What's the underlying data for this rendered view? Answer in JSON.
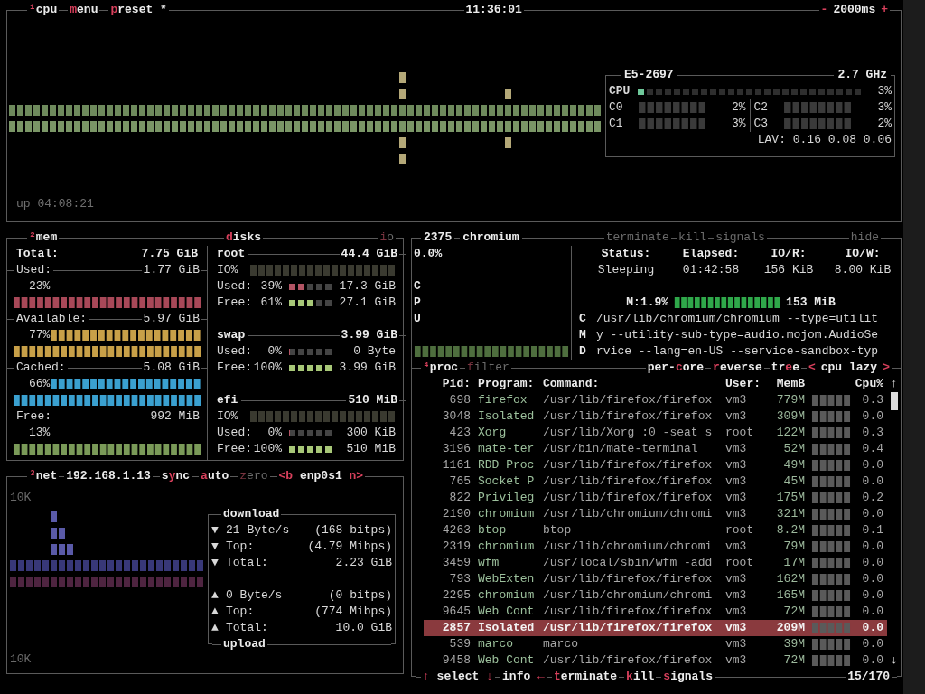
{
  "top_bar": {
    "tabs": [
      {
        "on": true,
        "parts": [
          {
            "text": "¹",
            "hot": true
          },
          {
            "text": "cpu",
            "hot": false
          }
        ]
      },
      {
        "on": true,
        "parts": [
          {
            "text": "m",
            "hot": true
          },
          {
            "text": "enu",
            "hot": false
          }
        ]
      },
      {
        "on": true,
        "parts": [
          {
            "text": "p",
            "hot": true
          },
          {
            "text": "reset *",
            "hot": false
          }
        ]
      }
    ],
    "clock": "11:36:01",
    "interval": {
      "minus": "-",
      "value": "2000ms",
      "plus": "+"
    }
  },
  "cpu": {
    "uptime": "up 04:08:21",
    "model": "E5-2697",
    "freq": "2.7 GHz",
    "total": {
      "label": "CPU",
      "level": 0.03,
      "reading": "3%"
    },
    "cores": [
      {
        "label": "C0",
        "reading": "2%"
      },
      {
        "label": "C2",
        "reading": "3%"
      },
      {
        "label": "C1",
        "reading": "3%"
      },
      {
        "label": "C3",
        "reading": "2%"
      }
    ],
    "load": "LAV: 0.16 0.08 0.06"
  },
  "mem": {
    "tab": {
      "on": true,
      "parts": [
        {
          "text": "²",
          "hot": true
        },
        {
          "text": "mem",
          "hot": false
        }
      ]
    },
    "total_label": "Total:",
    "total": "7.75 GiB",
    "rows": [
      {
        "label": "Used:",
        "value": "1.77 GiB",
        "percent": "23%",
        "kind": "separate",
        "color": "#a84858"
      },
      {
        "label": "Available:",
        "value": "5.97 GiB",
        "percent": "77%",
        "kind": "inline",
        "color": "#c8a048"
      },
      {
        "label": "Cached:",
        "value": "5.08 GiB",
        "percent": "66%",
        "kind": "inline",
        "color": "#3aa0d0"
      },
      {
        "label": "Free:",
        "value": "992 MiB",
        "percent": "13%",
        "kind": "separate",
        "color": "#7a9a58"
      }
    ]
  },
  "disks": {
    "tab": {
      "on": true,
      "parts": [
        {
          "text": "d",
          "hot": true
        },
        {
          "text": "isks",
          "hot": false
        }
      ]
    },
    "io_tab": {
      "on": false,
      "parts": [
        {
          "text": "i",
          "hot": true
        },
        {
          "text": "o",
          "hot": false
        }
      ]
    },
    "items": [
      {
        "name": "root",
        "size": "44.4 GiB",
        "io_label": "IO%",
        "used": {
          "label": "Used:",
          "percent": "39%",
          "level": 0.39,
          "value": "17.3 GiB"
        },
        "free": {
          "label": "Free:",
          "percent": "61%",
          "level": 0.61,
          "value": "27.1 GiB"
        }
      },
      {
        "name": "swap",
        "size": "3.99 GiB",
        "used": {
          "label": "Used:",
          "percent": "0%",
          "level": 0,
          "value": "0 Byte"
        },
        "free": {
          "label": "Free:",
          "percent": "100%",
          "level": 1,
          "value": "3.99 GiB"
        }
      },
      {
        "name": "efi",
        "size": "510 MiB",
        "io_label": "IO%",
        "used": {
          "label": "Used:",
          "percent": "0%",
          "level": 0,
          "value": "300 KiB"
        },
        "free": {
          "label": "Free:",
          "percent": "100%",
          "level": 1,
          "value": "510 MiB"
        }
      }
    ]
  },
  "net": {
    "tab": {
      "on": true,
      "parts": [
        {
          "text": "³",
          "hot": true
        },
        {
          "text": "net",
          "hot": false
        }
      ]
    },
    "ip": "192.168.1.13",
    "toggles": [
      {
        "on": true,
        "parts": [
          {
            "text": "s",
            "hot": false
          },
          {
            "text": "y",
            "hot": true
          },
          {
            "text": "nc",
            "hot": false
          }
        ]
      },
      {
        "on": true,
        "parts": [
          {
            "text": "a",
            "hot": true
          },
          {
            "text": "uto",
            "hot": false
          }
        ]
      },
      {
        "on": false,
        "parts": [
          {
            "text": "z",
            "hot": true
          },
          {
            "text": "ero",
            "hot": false
          }
        ]
      },
      {
        "on": true,
        "parts": [
          {
            "text": "<b",
            "hot": true
          },
          {
            "text": " enp0s1 ",
            "hot": false
          },
          {
            "text": "n>",
            "hot": true
          }
        ]
      }
    ],
    "scale_top": "10K",
    "scale_bottom": "10K",
    "download": {
      "title": "download",
      "rows": [
        {
          "arrow": "▼",
          "label": "21 Byte/s",
          "value": "(168 bitps)"
        },
        {
          "arrow": "▼",
          "label": "Top:",
          "value": "(4.79 Mibps)"
        },
        {
          "arrow": "▼",
          "label": "Total:",
          "value": "2.23 GiB"
        }
      ]
    },
    "upload": {
      "title": "upload",
      "rows": [
        {
          "arrow": "▲",
          "label": "0 Byte/s",
          "value": "(0 bitps)"
        },
        {
          "arrow": "▲",
          "label": "Top:",
          "value": "(774 Mibps)"
        },
        {
          "arrow": "▲",
          "label": "Total:",
          "value": "10.0 GiB"
        }
      ]
    }
  },
  "detail": {
    "pid": "2375",
    "name": "chromium",
    "buttons": [
      {
        "on": false,
        "parts": [
          {
            "text": "terminate",
            "hot": false
          }
        ]
      },
      {
        "on": false,
        "parts": [
          {
            "text": "kill",
            "hot": false
          }
        ]
      },
      {
        "on": false,
        "parts": [
          {
            "text": "signals",
            "hot": false
          }
        ]
      }
    ],
    "hide": {
      "on": false,
      "parts": [
        {
          "text": "hide",
          "hot": false
        }
      ]
    },
    "cpu_percent": "0.0%",
    "cpu_label": "CPU",
    "stats": [
      {
        "label": "Status:",
        "value": "Sleeping"
      },
      {
        "label": "Elapsed:",
        "value": "01:42:58"
      },
      {
        "label": "IO/R:",
        "value": "156 KiB"
      },
      {
        "label": "IO/W:",
        "value": "8.00 KiB"
      }
    ],
    "mem_percent": "M:1.9%",
    "mem_value": "153 MiB",
    "cmd_label": "CMD",
    "command": [
      "/usr/lib/chromium/chromium --type=utilit",
      "y --utility-sub-type=audio.mojom.AudioSe",
      "rvice --lang=en-US --service-sandbox-typ"
    ]
  },
  "proc": {
    "tabs_left": [
      {
        "on": true,
        "parts": [
          {
            "text": "⁴",
            "hot": true
          },
          {
            "text": "proc",
            "hot": false
          }
        ]
      },
      {
        "on": false,
        "parts": [
          {
            "text": "f",
            "hot": true
          },
          {
            "text": "ilter",
            "hot": false
          }
        ]
      }
    ],
    "tabs_right": [
      {
        "on": true,
        "parts": [
          {
            "text": "per-",
            "hot": false
          },
          {
            "text": "c",
            "hot": true
          },
          {
            "text": "ore",
            "hot": false
          }
        ]
      },
      {
        "on": true,
        "parts": [
          {
            "text": "r",
            "hot": true
          },
          {
            "text": "everse",
            "hot": false
          }
        ]
      },
      {
        "on": true,
        "parts": [
          {
            "text": "tr",
            "hot": false
          },
          {
            "text": "e",
            "hot": true
          },
          {
            "text": "e",
            "hot": false
          }
        ]
      }
    ],
    "sort": {
      "prev": "<",
      "value": "cpu lazy",
      "next": ">"
    },
    "columns": [
      "Pid:",
      "Program:",
      "Command:",
      "User:",
      "MemB",
      "Cpu%"
    ],
    "scroll_up": "↑",
    "scroll_down": "↓",
    "rows": [
      {
        "pid": "698",
        "program": "firefox",
        "command": "/usr/lib/firefox/firefox",
        "user": "vm3",
        "mem": "779M",
        "cpu": "0.3",
        "selected": false
      },
      {
        "pid": "3048",
        "program": "Isolated",
        "command": "/usr/lib/firefox/firefox",
        "user": "vm3",
        "mem": "309M",
        "cpu": "0.0",
        "selected": false
      },
      {
        "pid": "423",
        "program": "Xorg",
        "command": "/usr/lib/Xorg :0 -seat s",
        "user": "root",
        "mem": "122M",
        "cpu": "0.3",
        "selected": false
      },
      {
        "pid": "3196",
        "program": "mate-ter",
        "command": "/usr/bin/mate-terminal",
        "user": "vm3",
        "mem": "52M",
        "cpu": "0.4",
        "selected": false
      },
      {
        "pid": "1161",
        "program": "RDD Proc",
        "command": "/usr/lib/firefox/firefox",
        "user": "vm3",
        "mem": "49M",
        "cpu": "0.0",
        "selected": false
      },
      {
        "pid": "765",
        "program": "Socket P",
        "command": "/usr/lib/firefox/firefox",
        "user": "vm3",
        "mem": "45M",
        "cpu": "0.0",
        "selected": false
      },
      {
        "pid": "822",
        "program": "Privileg",
        "command": "/usr/lib/firefox/firefox",
        "user": "vm3",
        "mem": "175M",
        "cpu": "0.2",
        "selected": false
      },
      {
        "pid": "2190",
        "program": "chromium",
        "command": "/usr/lib/chromium/chromi",
        "user": "vm3",
        "mem": "321M",
        "cpu": "0.0",
        "selected": false
      },
      {
        "pid": "4263",
        "program": "btop",
        "command": "btop",
        "user": "root",
        "mem": "8.2M",
        "cpu": "0.1",
        "selected": false
      },
      {
        "pid": "2319",
        "program": "chromium",
        "command": "/usr/lib/chromium/chromi",
        "user": "vm3",
        "mem": "79M",
        "cpu": "0.0",
        "selected": false
      },
      {
        "pid": "3459",
        "program": "wfm",
        "command": "/usr/local/sbin/wfm -add",
        "user": "root",
        "mem": "17M",
        "cpu": "0.0",
        "selected": false
      },
      {
        "pid": "793",
        "program": "WebExten",
        "command": "/usr/lib/firefox/firefox",
        "user": "vm3",
        "mem": "162M",
        "cpu": "0.0",
        "selected": false
      },
      {
        "pid": "2295",
        "program": "chromium",
        "command": "/usr/lib/chromium/chromi",
        "user": "vm3",
        "mem": "165M",
        "cpu": "0.0",
        "selected": false
      },
      {
        "pid": "9645",
        "program": "Web Cont",
        "command": "/usr/lib/firefox/firefox",
        "user": "vm3",
        "mem": "72M",
        "cpu": "0.0",
        "selected": false
      },
      {
        "pid": "2857",
        "program": "Isolated",
        "command": "/usr/lib/firefox/firefox",
        "user": "vm3",
        "mem": "209M",
        "cpu": "0.0",
        "selected": true
      },
      {
        "pid": "539",
        "program": "marco",
        "command": "marco",
        "user": "vm3",
        "mem": "39M",
        "cpu": "0.0",
        "selected": false
      },
      {
        "pid": "9458",
        "program": "Web Cont",
        "command": "/usr/lib/firefox/firefox",
        "user": "vm3",
        "mem": "72M",
        "cpu": "0.0",
        "selected": false
      }
    ],
    "footer_tabs": [
      {
        "on": true,
        "parts": [
          {
            "text": "↑",
            "hot": true
          },
          {
            "text": " select ",
            "hot": false
          },
          {
            "text": "↓",
            "hot": true
          }
        ]
      },
      {
        "on": true,
        "parts": [
          {
            "text": "info ",
            "hot": false
          },
          {
            "text": "←",
            "hot": true
          }
        ]
      },
      {
        "on": true,
        "parts": [
          {
            "text": "t",
            "hot": true
          },
          {
            "text": "erminate",
            "hot": false
          }
        ]
      },
      {
        "on": true,
        "parts": [
          {
            "text": "k",
            "hot": true
          },
          {
            "text": "ill",
            "hot": false
          }
        ]
      },
      {
        "on": true,
        "parts": [
          {
            "text": "s",
            "hot": true
          },
          {
            "text": "ignals",
            "hot": false
          }
        ]
      }
    ],
    "count": "15/170"
  }
}
